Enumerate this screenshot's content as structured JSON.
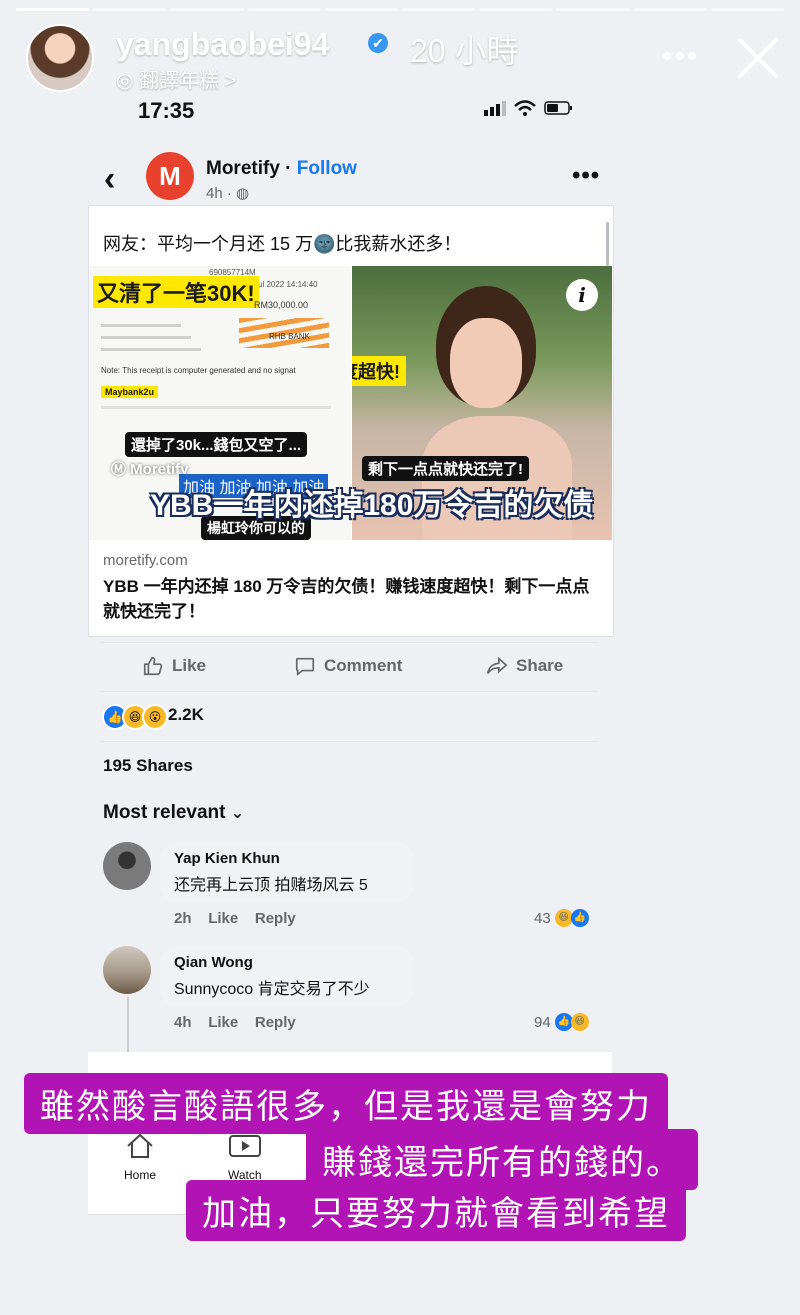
{
  "story": {
    "username": "yangbaobei94",
    "verified_mark": "✔",
    "time_ago": "20 小時",
    "translate_label": "翻譯年糕",
    "translate_chevron": ">",
    "more": "•••",
    "progress_segments": 10,
    "progress_done": 1
  },
  "status_bar": {
    "time": "17:35"
  },
  "post": {
    "page_name": "Moretify",
    "page_logo": "M",
    "separator": " · ",
    "follow_label": "Follow",
    "time": "4h · ",
    "audience_icon": "globe-icon",
    "text": "网友：平均一个月还 15 万🌚比我薪水还多！",
    "image": {
      "banner_top": "又清了一笔30K!",
      "receipt_amount": "RM30,000.00",
      "receipt_ref": "690857714M",
      "receipt_date": "Jul 2022 14:14:40",
      "receipt_bank": "RHB BANK",
      "receipt_note": "Note: This receipt is computer generated and no signat",
      "receipt_brand": "Maybank2u",
      "sticker_paid": "還掉了30k...錢包又空了...",
      "watermark": "Moretify",
      "sticker_cheer": "加油 加油 加油 加油",
      "sticker_name": "楊虹玲你可以的",
      "banner_fast": "赚钱速度超快!",
      "banner_almost": "剩下一点点就快还完了!",
      "caption": "YBB一年内还掉180万令吉的欠债",
      "info": "i"
    },
    "domain": "moretify.com",
    "headline": "YBB 一年内还掉 180 万令吉的欠债！赚钱速度超快！剩下一点点就快还完了！",
    "actions": {
      "like": "Like",
      "comment": "Comment",
      "share": "Share"
    },
    "reaction_count": "2.2K",
    "shares": "195 Shares",
    "sort_label": "Most relevant",
    "sort_chevron": "⌄"
  },
  "comments": [
    {
      "name": "Yap Kien Khun",
      "text": "还完再上云顶 拍赌场风云 5",
      "time": "2h",
      "like": "Like",
      "reply": "Reply",
      "count": "43"
    },
    {
      "name": "Qian Wong",
      "text": "Sunnycoco 肯定交易了不少",
      "time": "4h",
      "like": "Like",
      "reply": "Reply",
      "count": "94"
    }
  ],
  "nav": {
    "home": "Home",
    "watch": "Watch"
  },
  "overlay": {
    "line1": "雖然酸言酸語很多，但是我還是會努力",
    "line2": "賺錢還完所有的錢的。",
    "line3": "加油，只要努力就會看到希望"
  },
  "colors": {
    "overlay": "#b113b5",
    "facebook_blue": "#1877f2",
    "page_logo": "#e8412d"
  }
}
